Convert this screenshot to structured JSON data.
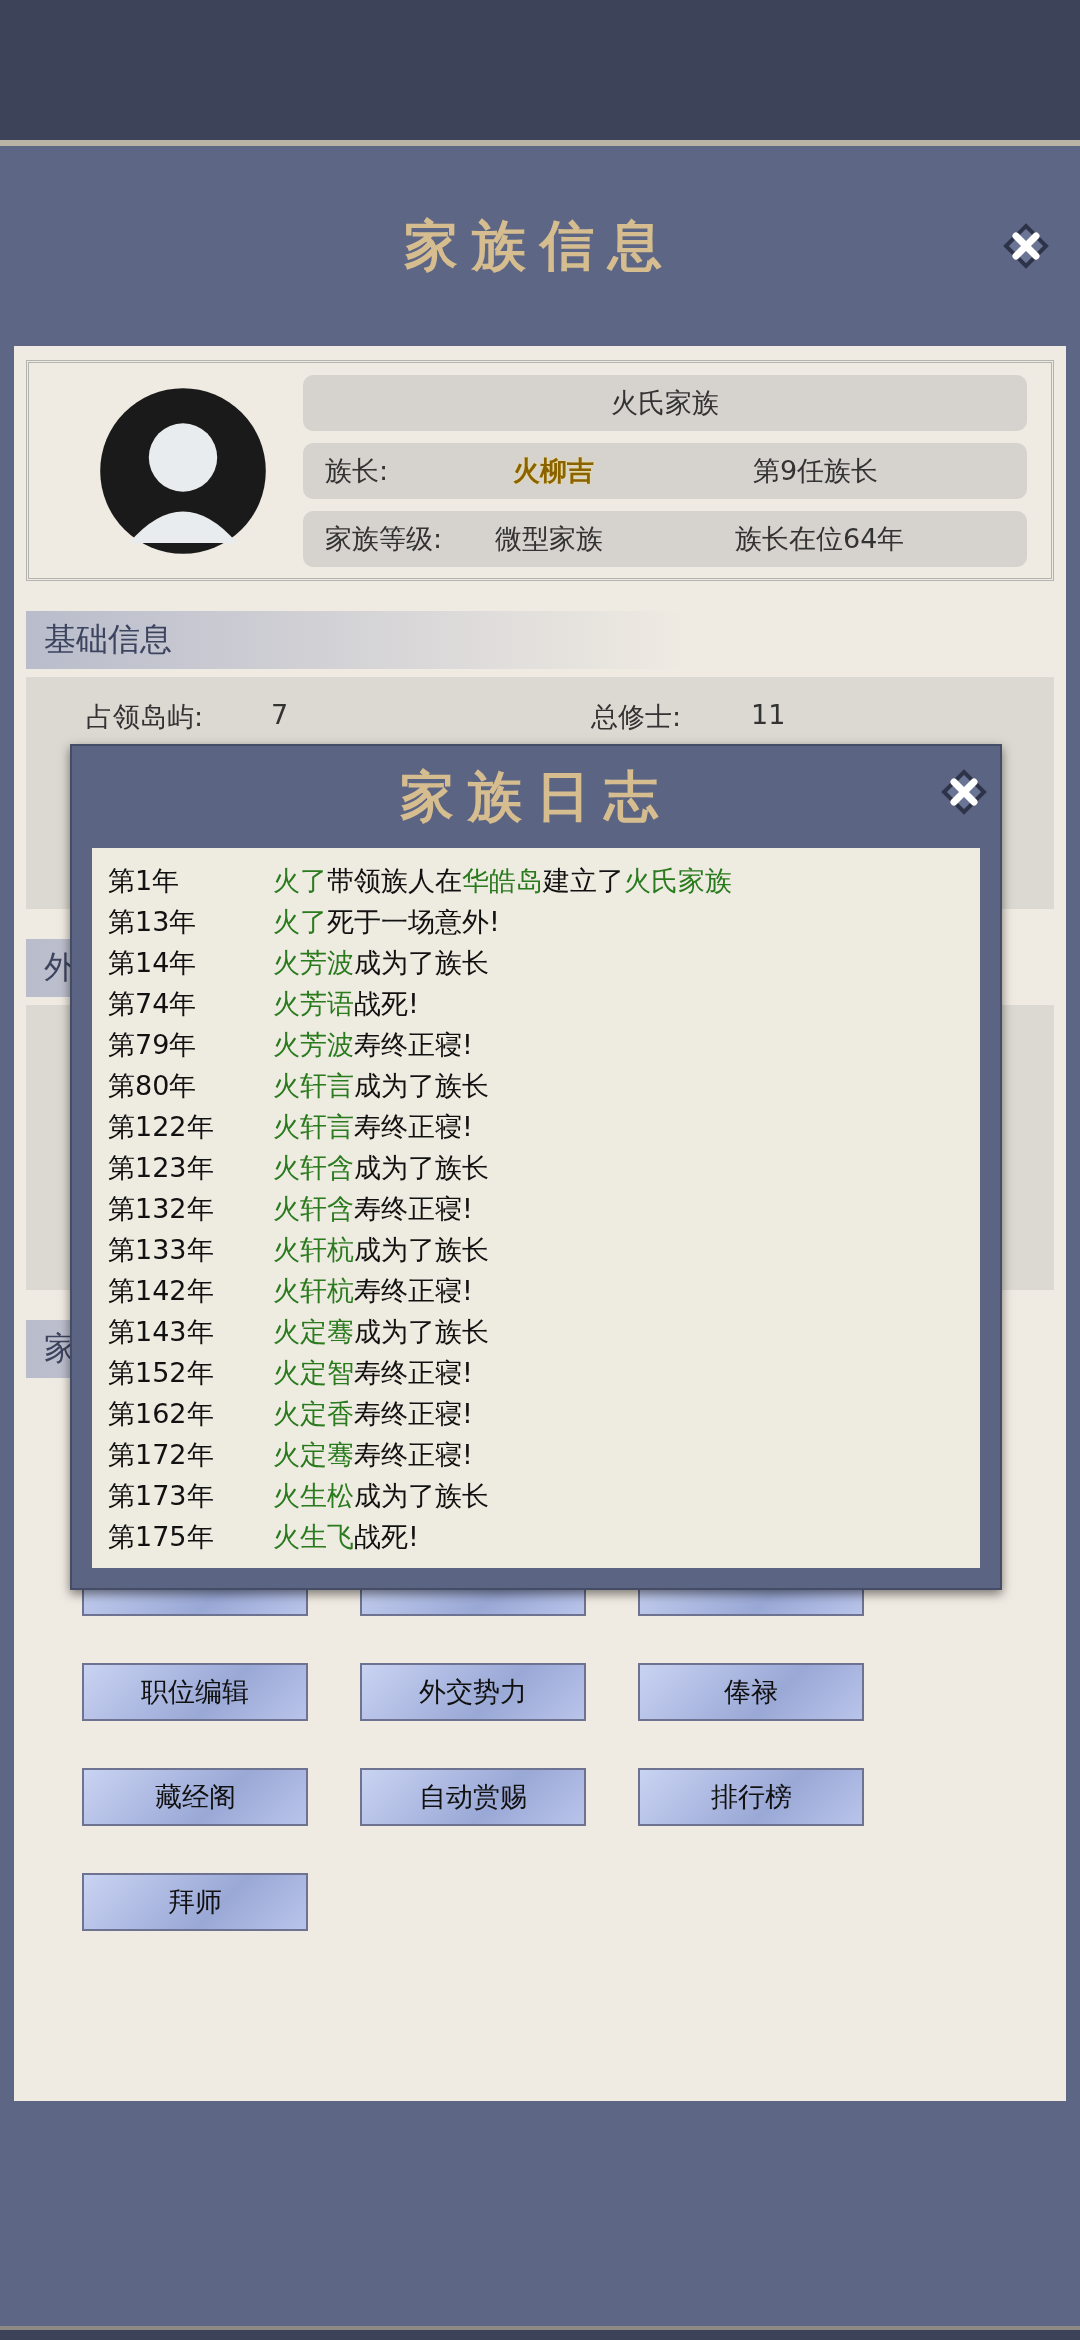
{
  "title": "家族信息",
  "family": {
    "name": "火氏家族",
    "rows": [
      {
        "kind": "leader",
        "label": "族长:",
        "value": "火柳吉",
        "extra": "第9任族长"
      },
      {
        "kind": "plain",
        "label": "家族等级:",
        "value": "微型家族",
        "extra": "族长在位64年"
      }
    ]
  },
  "sections": [
    {
      "kind": "stats",
      "title": "基础信息",
      "stats": [
        {
          "label": "占领岛屿:",
          "value": "7"
        },
        {
          "label": "总修士:",
          "value": "11"
        }
      ]
    },
    {
      "kind": "box",
      "title": "外"
    },
    {
      "kind": "buttons",
      "title": "家",
      "buttons": [
        {
          "kind": "covered"
        },
        {
          "kind": "covered"
        },
        {
          "kind": "covered"
        },
        {
          "kind": "label",
          "label": "职位编辑"
        },
        {
          "kind": "label",
          "label": "外交势力"
        },
        {
          "kind": "label",
          "label": "俸禄"
        },
        {
          "kind": "label",
          "label": "藏经阁"
        },
        {
          "kind": "label",
          "label": "自动赏赐"
        },
        {
          "kind": "label",
          "label": "排行榜"
        },
        {
          "kind": "label",
          "label": "拜师"
        }
      ]
    }
  ],
  "log": {
    "title": "家族日志",
    "entries": [
      {
        "year": "第1年",
        "parts": [
          {
            "text": "火了",
            "highlight": true
          },
          {
            "text": "带领族人在",
            "highlight": false
          },
          {
            "text": "华皓岛",
            "highlight": true
          },
          {
            "text": "建立了",
            "highlight": false
          },
          {
            "text": "火氏家族",
            "highlight": true
          }
        ]
      },
      {
        "year": "第13年",
        "parts": [
          {
            "text": "火了",
            "highlight": true
          },
          {
            "text": "死于一场意外!",
            "highlight": false
          }
        ]
      },
      {
        "year": "第14年",
        "parts": [
          {
            "text": "火芳波",
            "highlight": true
          },
          {
            "text": "成为了族长",
            "highlight": false
          }
        ]
      },
      {
        "year": "第74年",
        "parts": [
          {
            "text": "火芳语",
            "highlight": true
          },
          {
            "text": "战死!",
            "highlight": false
          }
        ]
      },
      {
        "year": "第79年",
        "parts": [
          {
            "text": "火芳波",
            "highlight": true
          },
          {
            "text": "寿终正寝!",
            "highlight": false
          }
        ]
      },
      {
        "year": "第80年",
        "parts": [
          {
            "text": "火轩言",
            "highlight": true
          },
          {
            "text": "成为了族长",
            "highlight": false
          }
        ]
      },
      {
        "year": "第122年",
        "parts": [
          {
            "text": "火轩言",
            "highlight": true
          },
          {
            "text": "寿终正寝!",
            "highlight": false
          }
        ]
      },
      {
        "year": "第123年",
        "parts": [
          {
            "text": "火轩含",
            "highlight": true
          },
          {
            "text": "成为了族长",
            "highlight": false
          }
        ]
      },
      {
        "year": "第132年",
        "parts": [
          {
            "text": "火轩含",
            "highlight": true
          },
          {
            "text": "寿终正寝!",
            "highlight": false
          }
        ]
      },
      {
        "year": "第133年",
        "parts": [
          {
            "text": "火轩杭",
            "highlight": true
          },
          {
            "text": "成为了族长",
            "highlight": false
          }
        ]
      },
      {
        "year": "第142年",
        "parts": [
          {
            "text": "火轩杭",
            "highlight": true
          },
          {
            "text": "寿终正寝!",
            "highlight": false
          }
        ]
      },
      {
        "year": "第143年",
        "parts": [
          {
            "text": "火定骞",
            "highlight": true
          },
          {
            "text": "成为了族长",
            "highlight": false
          }
        ]
      },
      {
        "year": "第152年",
        "parts": [
          {
            "text": "火定智",
            "highlight": true
          },
          {
            "text": "寿终正寝!",
            "highlight": false
          }
        ]
      },
      {
        "year": "第162年",
        "parts": [
          {
            "text": "火定香",
            "highlight": true
          },
          {
            "text": "寿终正寝!",
            "highlight": false
          }
        ]
      },
      {
        "year": "第172年",
        "parts": [
          {
            "text": "火定骞",
            "highlight": true
          },
          {
            "text": "寿终正寝!",
            "highlight": false
          }
        ]
      },
      {
        "year": "第173年",
        "parts": [
          {
            "text": "火生松",
            "highlight": true
          },
          {
            "text": "成为了族长",
            "highlight": false
          }
        ]
      },
      {
        "year": "第175年",
        "parts": [
          {
            "text": "火生飞",
            "highlight": true
          },
          {
            "text": "战死!",
            "highlight": false
          }
        ]
      }
    ]
  }
}
